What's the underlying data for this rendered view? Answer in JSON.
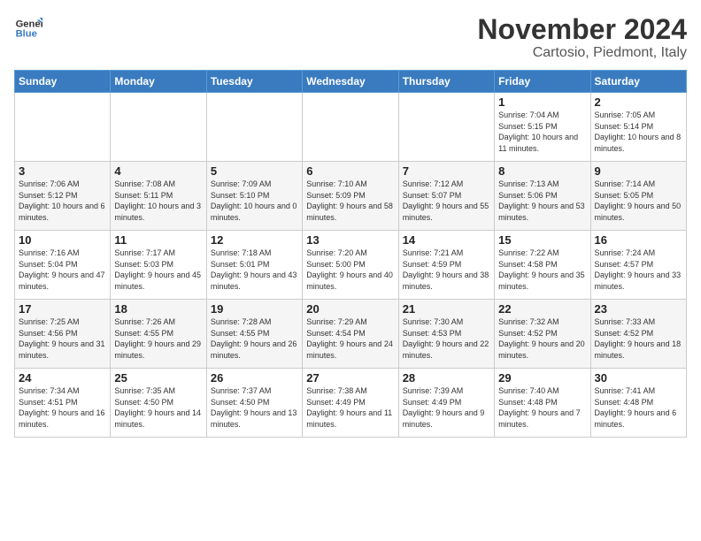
{
  "logo": {
    "line1": "General",
    "line2": "Blue"
  },
  "title": "November 2024",
  "location": "Cartosio, Piedmont, Italy",
  "header_days": [
    "Sunday",
    "Monday",
    "Tuesday",
    "Wednesday",
    "Thursday",
    "Friday",
    "Saturday"
  ],
  "weeks": [
    [
      {
        "day": "",
        "info": ""
      },
      {
        "day": "",
        "info": ""
      },
      {
        "day": "",
        "info": ""
      },
      {
        "day": "",
        "info": ""
      },
      {
        "day": "",
        "info": ""
      },
      {
        "day": "1",
        "info": "Sunrise: 7:04 AM\nSunset: 5:15 PM\nDaylight: 10 hours and 11 minutes."
      },
      {
        "day": "2",
        "info": "Sunrise: 7:05 AM\nSunset: 5:14 PM\nDaylight: 10 hours and 8 minutes."
      }
    ],
    [
      {
        "day": "3",
        "info": "Sunrise: 7:06 AM\nSunset: 5:12 PM\nDaylight: 10 hours and 6 minutes."
      },
      {
        "day": "4",
        "info": "Sunrise: 7:08 AM\nSunset: 5:11 PM\nDaylight: 10 hours and 3 minutes."
      },
      {
        "day": "5",
        "info": "Sunrise: 7:09 AM\nSunset: 5:10 PM\nDaylight: 10 hours and 0 minutes."
      },
      {
        "day": "6",
        "info": "Sunrise: 7:10 AM\nSunset: 5:09 PM\nDaylight: 9 hours and 58 minutes."
      },
      {
        "day": "7",
        "info": "Sunrise: 7:12 AM\nSunset: 5:07 PM\nDaylight: 9 hours and 55 minutes."
      },
      {
        "day": "8",
        "info": "Sunrise: 7:13 AM\nSunset: 5:06 PM\nDaylight: 9 hours and 53 minutes."
      },
      {
        "day": "9",
        "info": "Sunrise: 7:14 AM\nSunset: 5:05 PM\nDaylight: 9 hours and 50 minutes."
      }
    ],
    [
      {
        "day": "10",
        "info": "Sunrise: 7:16 AM\nSunset: 5:04 PM\nDaylight: 9 hours and 47 minutes."
      },
      {
        "day": "11",
        "info": "Sunrise: 7:17 AM\nSunset: 5:03 PM\nDaylight: 9 hours and 45 minutes."
      },
      {
        "day": "12",
        "info": "Sunrise: 7:18 AM\nSunset: 5:01 PM\nDaylight: 9 hours and 43 minutes."
      },
      {
        "day": "13",
        "info": "Sunrise: 7:20 AM\nSunset: 5:00 PM\nDaylight: 9 hours and 40 minutes."
      },
      {
        "day": "14",
        "info": "Sunrise: 7:21 AM\nSunset: 4:59 PM\nDaylight: 9 hours and 38 minutes."
      },
      {
        "day": "15",
        "info": "Sunrise: 7:22 AM\nSunset: 4:58 PM\nDaylight: 9 hours and 35 minutes."
      },
      {
        "day": "16",
        "info": "Sunrise: 7:24 AM\nSunset: 4:57 PM\nDaylight: 9 hours and 33 minutes."
      }
    ],
    [
      {
        "day": "17",
        "info": "Sunrise: 7:25 AM\nSunset: 4:56 PM\nDaylight: 9 hours and 31 minutes."
      },
      {
        "day": "18",
        "info": "Sunrise: 7:26 AM\nSunset: 4:55 PM\nDaylight: 9 hours and 29 minutes."
      },
      {
        "day": "19",
        "info": "Sunrise: 7:28 AM\nSunset: 4:55 PM\nDaylight: 9 hours and 26 minutes."
      },
      {
        "day": "20",
        "info": "Sunrise: 7:29 AM\nSunset: 4:54 PM\nDaylight: 9 hours and 24 minutes."
      },
      {
        "day": "21",
        "info": "Sunrise: 7:30 AM\nSunset: 4:53 PM\nDaylight: 9 hours and 22 minutes."
      },
      {
        "day": "22",
        "info": "Sunrise: 7:32 AM\nSunset: 4:52 PM\nDaylight: 9 hours and 20 minutes."
      },
      {
        "day": "23",
        "info": "Sunrise: 7:33 AM\nSunset: 4:52 PM\nDaylight: 9 hours and 18 minutes."
      }
    ],
    [
      {
        "day": "24",
        "info": "Sunrise: 7:34 AM\nSunset: 4:51 PM\nDaylight: 9 hours and 16 minutes."
      },
      {
        "day": "25",
        "info": "Sunrise: 7:35 AM\nSunset: 4:50 PM\nDaylight: 9 hours and 14 minutes."
      },
      {
        "day": "26",
        "info": "Sunrise: 7:37 AM\nSunset: 4:50 PM\nDaylight: 9 hours and 13 minutes."
      },
      {
        "day": "27",
        "info": "Sunrise: 7:38 AM\nSunset: 4:49 PM\nDaylight: 9 hours and 11 minutes."
      },
      {
        "day": "28",
        "info": "Sunrise: 7:39 AM\nSunset: 4:49 PM\nDaylight: 9 hours and 9 minutes."
      },
      {
        "day": "29",
        "info": "Sunrise: 7:40 AM\nSunset: 4:48 PM\nDaylight: 9 hours and 7 minutes."
      },
      {
        "day": "30",
        "info": "Sunrise: 7:41 AM\nSunset: 4:48 PM\nDaylight: 9 hours and 6 minutes."
      }
    ]
  ]
}
